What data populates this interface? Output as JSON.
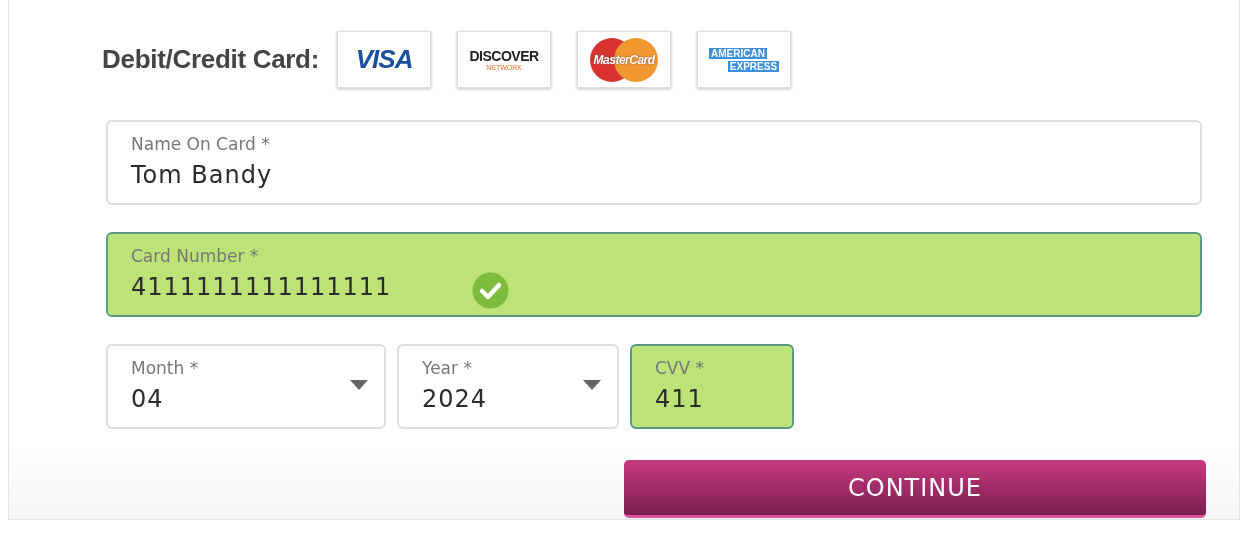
{
  "heading": "Debit/Credit Card:",
  "card_logos": [
    {
      "kind": "visa",
      "lines": [
        "VISA"
      ]
    },
    {
      "kind": "discover",
      "lines": [
        "DISCOVER",
        "NETWORK"
      ]
    },
    {
      "kind": "mastercard",
      "lines": [
        "MasterCard"
      ]
    },
    {
      "kind": "amex",
      "lines": [
        "AMERICAN",
        "EXPRESS"
      ]
    }
  ],
  "fields": [
    {
      "kind": "text",
      "label": "Name On Card *",
      "value": "Tom Bandy",
      "valid": false
    },
    {
      "kind": "text",
      "label": "Card Number *",
      "value": "4111111111111111",
      "valid": true,
      "checkmark": true
    },
    {
      "kind": "select",
      "label": "Month *",
      "value": "04",
      "valid": false
    },
    {
      "kind": "select",
      "label": "Year *",
      "value": "2024",
      "valid": false
    },
    {
      "kind": "text",
      "label": "CVV *",
      "value": "411",
      "valid": true
    }
  ],
  "continue_button": "CONTINUE"
}
